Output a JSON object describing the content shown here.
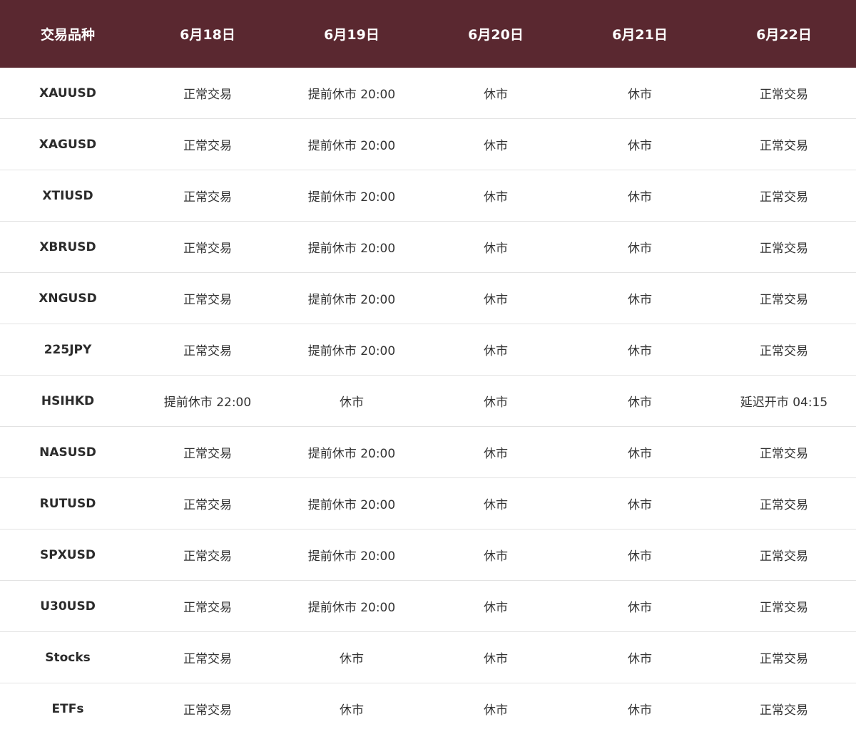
{
  "table": {
    "headers": [
      "交易品种",
      "6月18日",
      "6月19日",
      "6月20日",
      "6月21日",
      "6月22日"
    ],
    "rows": [
      [
        "XAUUSD",
        "正常交易",
        "提前休市 20:00",
        "休市",
        "休市",
        "正常交易"
      ],
      [
        "XAGUSD",
        "正常交易",
        "提前休市 20:00",
        "休市",
        "休市",
        "正常交易"
      ],
      [
        "XTIUSD",
        "正常交易",
        "提前休市 20:00",
        "休市",
        "休市",
        "正常交易"
      ],
      [
        "XBRUSD",
        "正常交易",
        "提前休市 20:00",
        "休市",
        "休市",
        "正常交易"
      ],
      [
        "XNGUSD",
        "正常交易",
        "提前休市 20:00",
        "休市",
        "休市",
        "正常交易"
      ],
      [
        "225JPY",
        "正常交易",
        "提前休市 20:00",
        "休市",
        "休市",
        "正常交易"
      ],
      [
        "HSIHKD",
        "提前休市 22:00",
        "休市",
        "休市",
        "休市",
        "延迟开市 04:15"
      ],
      [
        "NASUSD",
        "正常交易",
        "提前休市 20:00",
        "休市",
        "休市",
        "正常交易"
      ],
      [
        "RUTUSD",
        "正常交易",
        "提前休市 20:00",
        "休市",
        "休市",
        "正常交易"
      ],
      [
        "SPXUSD",
        "正常交易",
        "提前休市 20:00",
        "休市",
        "休市",
        "正常交易"
      ],
      [
        "U30USD",
        "正常交易",
        "提前休市 20:00",
        "休市",
        "休市",
        "正常交易"
      ],
      [
        "Stocks",
        "正常交易",
        "休市",
        "休市",
        "休市",
        "正常交易"
      ],
      [
        "ETFs",
        "正常交易",
        "休市",
        "休市",
        "休市",
        "正常交易"
      ]
    ]
  },
  "colors": {
    "header_background": "#5a2830",
    "header_text": "#ffffff",
    "row_divider": "#e2e2e2",
    "body_text": "#333333"
  }
}
